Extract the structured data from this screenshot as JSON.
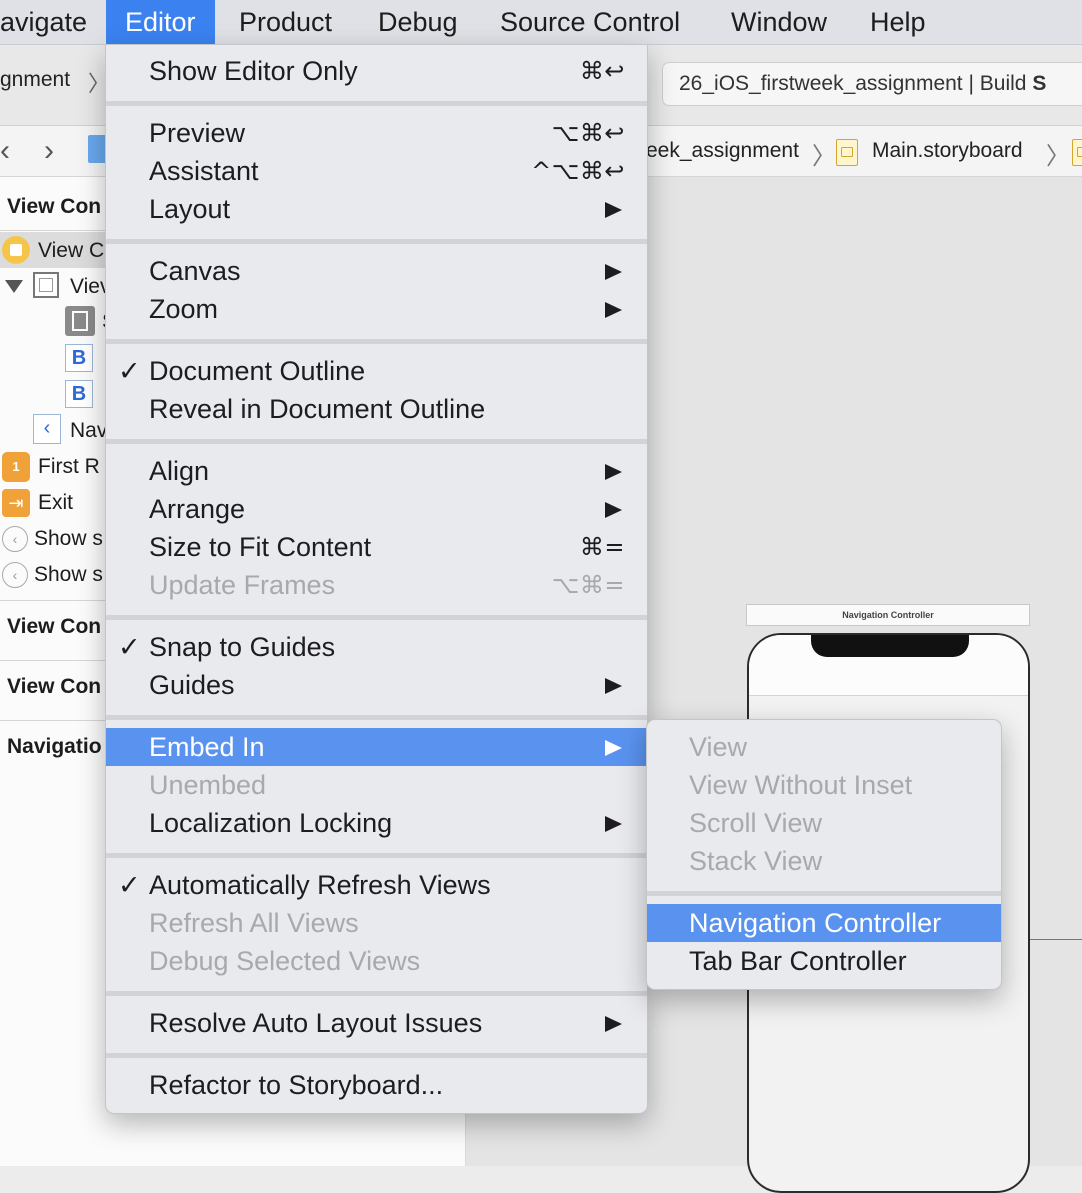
{
  "menubar": {
    "items": [
      "avigate",
      "Editor",
      "Product",
      "Debug",
      "Source Control",
      "Window",
      "Help"
    ]
  },
  "toolbar": {
    "scheme_label": "gnment",
    "status_prefix": "26_iOS_firstweek_assignment | Build ",
    "status_bold": "S"
  },
  "jumpbar": {
    "crumb_project": "eek_assignment",
    "crumb_file": "Main.storyboard"
  },
  "outline": {
    "vc_scene_1": "View Con",
    "vc_item": "View C",
    "view_item": "Viev",
    "safe_area": "S",
    "button_1": "B",
    "button_2": "B",
    "nav_item": "Nav",
    "first_responder": "First R",
    "exit": "Exit",
    "show_seg_1": "Show s",
    "show_seg_2": "Show s",
    "vc_scene_2": "View Con",
    "vc_scene_3": "View Con",
    "nav_scene": "Navigatio"
  },
  "canvas": {
    "nav_controller_title": "Navigation Controller"
  },
  "editor_menu": {
    "show_editor_only": {
      "label": "Show Editor Only",
      "shortcut": "⌘↩"
    },
    "preview": {
      "label": "Preview",
      "shortcut": "⌥⌘↩"
    },
    "assistant": {
      "label": "Assistant",
      "shortcut": "^⌥⌘↩"
    },
    "layout": {
      "label": "Layout"
    },
    "canvas": {
      "label": "Canvas"
    },
    "zoom": {
      "label": "Zoom"
    },
    "document_outline": {
      "label": "Document Outline",
      "checked": "✓"
    },
    "reveal_outline": {
      "label": "Reveal in Document Outline"
    },
    "align": {
      "label": "Align"
    },
    "arrange": {
      "label": "Arrange"
    },
    "size_to_fit": {
      "label": "Size to Fit Content",
      "shortcut": "⌘="
    },
    "update_frames": {
      "label": "Update Frames",
      "shortcut": "⌥⌘="
    },
    "snap_to_guides": {
      "label": "Snap to Guides",
      "checked": "✓"
    },
    "guides": {
      "label": "Guides"
    },
    "embed_in": {
      "label": "Embed In"
    },
    "unembed": {
      "label": "Unembed"
    },
    "localization_locking": {
      "label": "Localization Locking"
    },
    "auto_refresh": {
      "label": "Automatically Refresh Views",
      "checked": "✓"
    },
    "refresh_all": {
      "label": "Refresh All Views"
    },
    "debug_selected": {
      "label": "Debug Selected Views"
    },
    "resolve_auto_layout": {
      "label": "Resolve Auto Layout Issues"
    },
    "refactor": {
      "label": "Refactor to Storyboard..."
    }
  },
  "embed_menu": {
    "view": "View",
    "view_without_inset": "View Without Inset",
    "scroll_view": "Scroll View",
    "stack_view": "Stack View",
    "navigation_controller": "Navigation Controller",
    "tab_bar_controller": "Tab Bar Controller"
  },
  "colors": {
    "menu_highlight": "#5a93ef",
    "menubar_active": "#3b82f0",
    "disabled_text": "#a8a9ad"
  }
}
